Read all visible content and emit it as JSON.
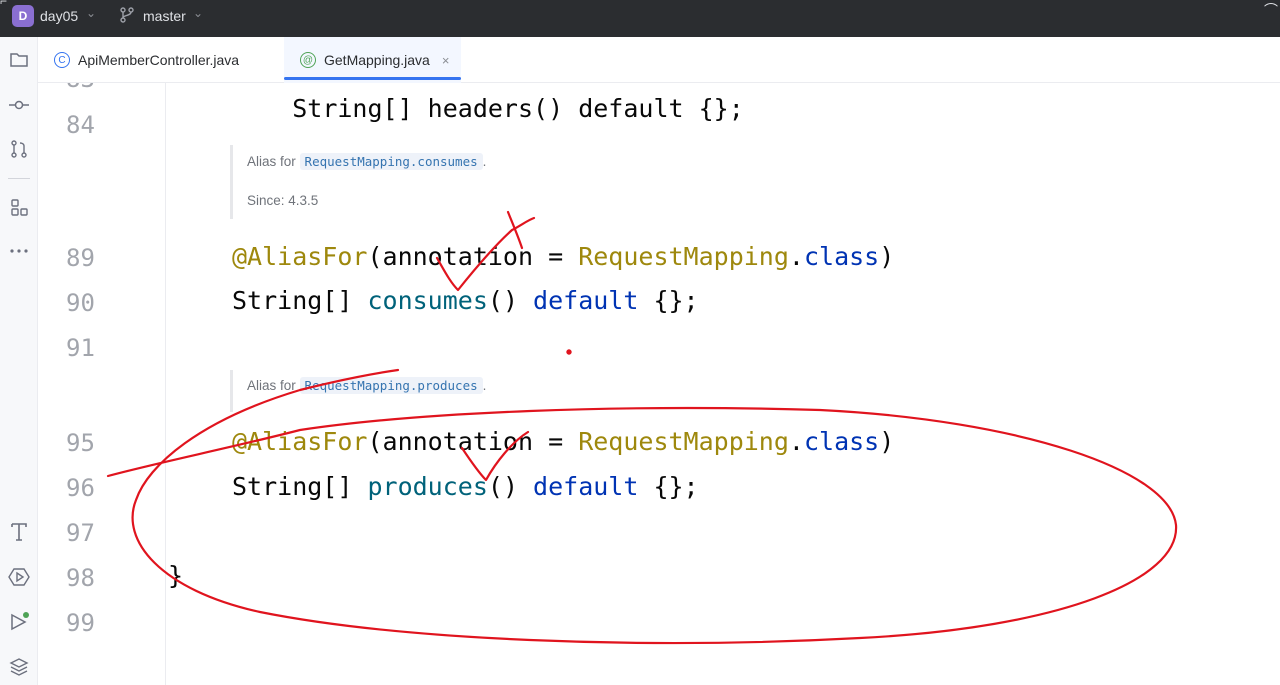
{
  "titlebar": {
    "project_badge": "D",
    "project_name": "day05",
    "branch_name": "master"
  },
  "tabs": [
    {
      "label": "ApiMemberController.java",
      "icon": "class-icon",
      "active": false
    },
    {
      "label": "GetMapping.java",
      "icon": "annotation-icon",
      "active": true,
      "close": "×"
    }
  ],
  "toolstrip": [
    "folder-icon",
    "commit-icon",
    "pull-requests-icon",
    "structure-icon",
    "more-icon",
    "notifications-icon",
    "services-icon",
    "run-icon",
    "layers-icon"
  ],
  "editor": {
    "line_numbers": [
      "84",
      "89",
      "90",
      "91",
      "95",
      "96",
      "97",
      "98",
      "99"
    ],
    "partial_top_line": "String[] headers() default {};",
    "doc1": {
      "alias_prefix": "Alias for",
      "alias_ref": "RequestMapping.consumes",
      "alias_suffix": ".",
      "since": "Since: 4.3.5"
    },
    "line89": {
      "ann": "@AliasFor",
      "open": "(annotation = ",
      "cls": "RequestMapping",
      "dot": ".",
      "kw": "class",
      "close": ")"
    },
    "line90": {
      "type": "String[] ",
      "meth": "consumes",
      "paren": "() ",
      "kw": "default",
      "tail": " {};"
    },
    "doc2": {
      "alias_prefix": "Alias for",
      "alias_ref": "RequestMapping.produces",
      "alias_suffix": "."
    },
    "line95": {
      "ann": "@AliasFor",
      "open": "(annotation = ",
      "cls": "RequestMapping",
      "dot": ".",
      "kw": "class",
      "close": ")"
    },
    "line96": {
      "type": "String[] ",
      "meth": "produces",
      "paren": "() ",
      "kw": "default",
      "tail": " {};"
    },
    "line98": "}"
  },
  "colors": {
    "annotation_pen": "#e0141e",
    "accent": "#3574f0"
  }
}
